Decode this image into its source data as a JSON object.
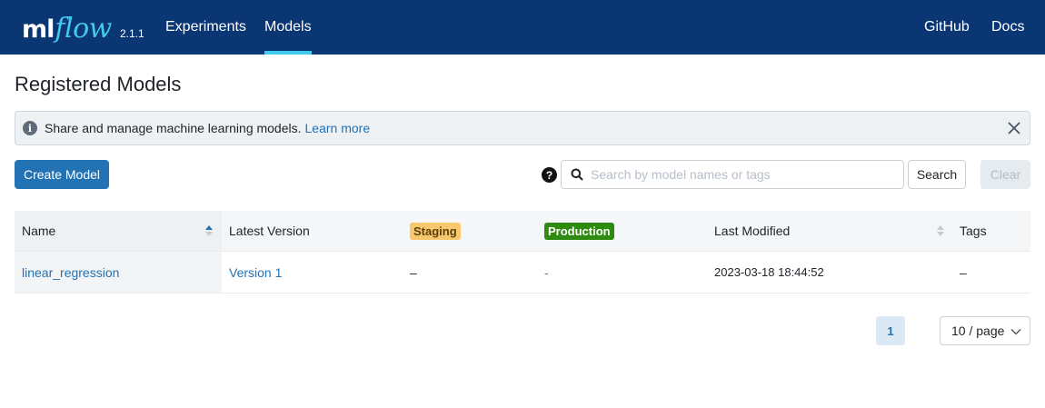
{
  "header": {
    "logo_ml": "ml",
    "logo_flow": "flow",
    "version": "2.1.1",
    "nav": [
      {
        "label": "Experiments"
      },
      {
        "label": "Models"
      }
    ],
    "right_links": [
      {
        "label": "GitHub"
      },
      {
        "label": "Docs"
      }
    ]
  },
  "page": {
    "title": "Registered Models"
  },
  "alert": {
    "text": "Share and manage machine learning models.",
    "link": "Learn more",
    "info_icon": "i"
  },
  "toolbar": {
    "create_label": "Create Model",
    "help_icon": "?",
    "search_placeholder": "Search by model names or tags",
    "search_value": "",
    "search_label": "Search",
    "clear_label": "Clear"
  },
  "table": {
    "columns": {
      "name": "Name",
      "latest_version": "Latest Version",
      "staging": "Staging",
      "production": "Production",
      "last_modified": "Last Modified",
      "tags": "Tags"
    },
    "rows": [
      {
        "name": "linear_regression",
        "latest_version": "Version 1",
        "staging": "–",
        "production": "-",
        "last_modified": "2023-03-18 18:44:52",
        "tags": "–"
      }
    ]
  },
  "pagination": {
    "current_page": "1",
    "page_size": "10 / page"
  },
  "colors": {
    "header_bg": "#0b3674",
    "accent": "#43c9ed",
    "link": "#2272b4",
    "staging_badge": "#f8c86c",
    "production_badge": "#2f8a12"
  }
}
